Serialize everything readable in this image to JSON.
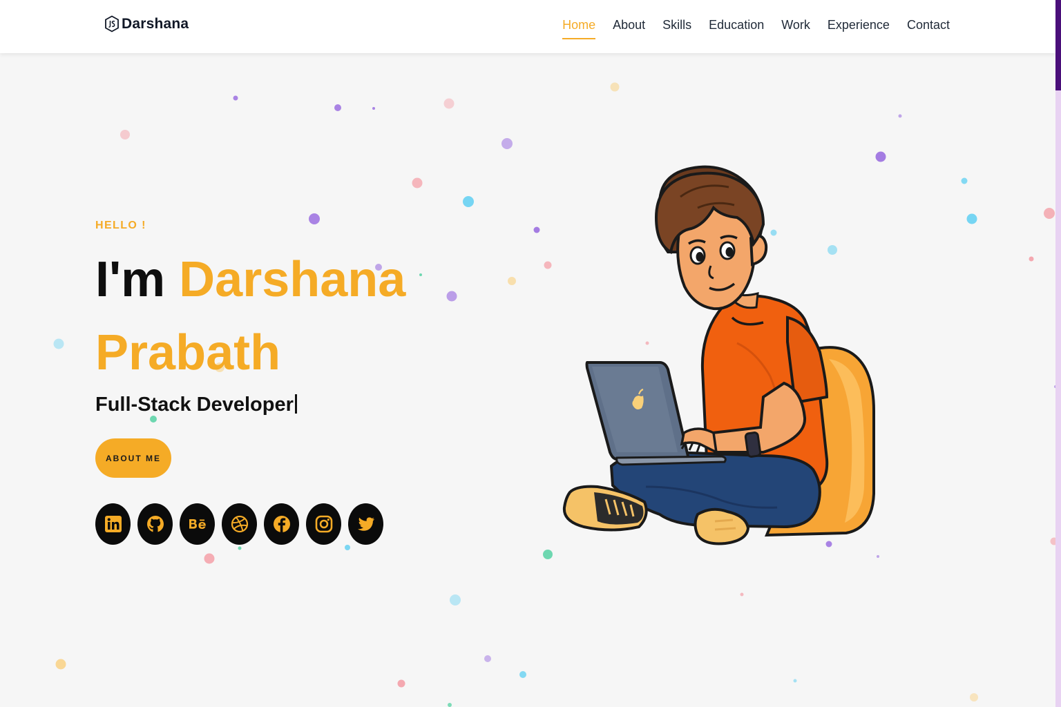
{
  "brand": {
    "name": "Darshana",
    "icon": "nodejs-hexagon-icon"
  },
  "nav": {
    "items": [
      {
        "label": "Home",
        "active": true
      },
      {
        "label": "About",
        "active": false
      },
      {
        "label": "Skills",
        "active": false
      },
      {
        "label": "Education",
        "active": false
      },
      {
        "label": "Work",
        "active": false
      },
      {
        "label": "Experience",
        "active": false
      },
      {
        "label": "Contact",
        "active": false
      }
    ]
  },
  "hero": {
    "greeting": "HELLO !",
    "intro": "I'm",
    "name_first": "Darshana",
    "name_last": "Prabath",
    "role": "Full-Stack Developer",
    "button_label": "ABOUT ME"
  },
  "socials": [
    {
      "icon": "linkedin-icon"
    },
    {
      "icon": "github-icon"
    },
    {
      "icon": "behance-icon"
    },
    {
      "icon": "dribbble-icon"
    },
    {
      "icon": "facebook-icon"
    },
    {
      "icon": "instagram-icon"
    },
    {
      "icon": "twitter-icon"
    }
  ],
  "illustration": {
    "subject": "developer-on-laptop-illustration"
  },
  "colors": {
    "accent": "#f5ab26",
    "text_dark": "#0e0e0e",
    "background": "#f6f6f6",
    "scrollbar_thumb": "#4a0f7a",
    "scrollbar_track": "#e8d2f2",
    "dot_palette": [
      "#9b6fe0",
      "#f4a0a8",
      "#6fd3f2",
      "#f9d58f",
      "#5fd4a8"
    ]
  }
}
